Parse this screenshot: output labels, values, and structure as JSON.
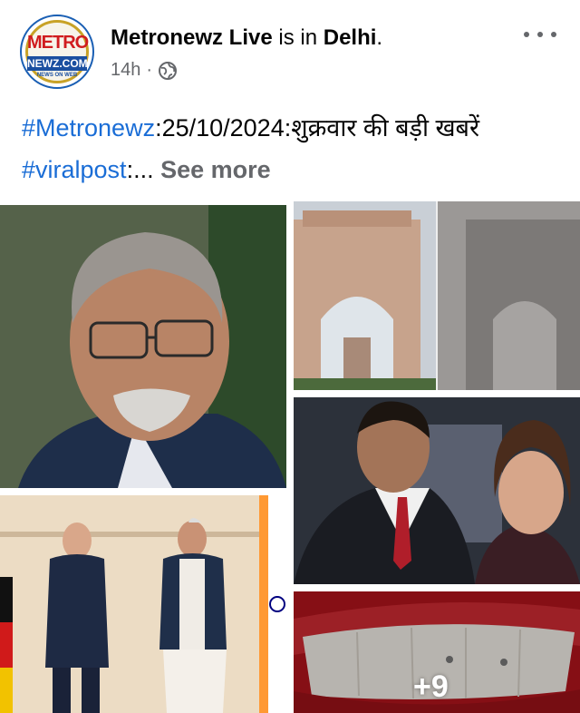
{
  "post": {
    "author": "Metronewz Live",
    "is_in": "is in",
    "location": "Delhi",
    "location_suffix": ".",
    "time": "14h",
    "time_sep": "·",
    "more_icon": "three-dots-icon",
    "privacy_icon": "globe-icon"
  },
  "avatar": {
    "logo_line1": "METRO",
    "logo_line2": "NEWZ.COM",
    "logo_line3": "NEWS ON WEB"
  },
  "caption": {
    "tag1": "#Metronewz",
    "text1": ":25/10/2024:शुक्रवार की बड़ी खबरें ",
    "tag2": "#viralpost",
    "text2": ":... ",
    "see_more": "See more"
  },
  "gallery": {
    "more_count": "+9"
  },
  "colors": {
    "link": "#1a6dd6",
    "secondary": "#65676b"
  }
}
